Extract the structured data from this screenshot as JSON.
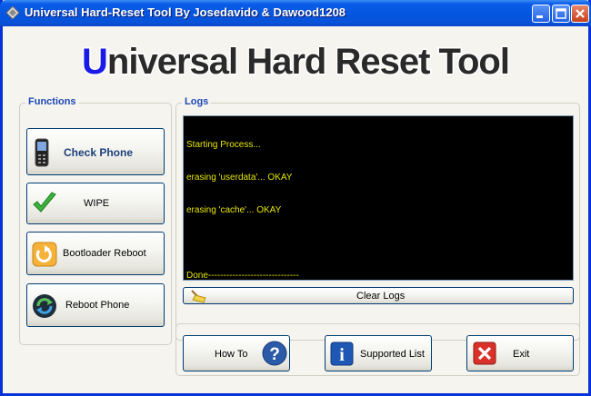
{
  "window": {
    "title": "Universal Hard-Reset Tool By Josedavido & Dawood1208"
  },
  "banner": {
    "text": "Universal Hard Reset Tool",
    "first_letter_color": "#1A1AE6",
    "text_color": "#222222"
  },
  "functions": {
    "label": "Functions",
    "buttons": [
      {
        "label": "Check Phone",
        "icon": "phone-icon"
      },
      {
        "label": "WIPE",
        "icon": "checkmark-icon"
      },
      {
        "label": "Bootloader Reboot",
        "icon": "reboot-arrow-icon"
      },
      {
        "label": "Reboot Phone",
        "icon": "refresh-circle-icon"
      }
    ]
  },
  "logs": {
    "label": "Logs",
    "lines": [
      "Starting Process...",
      "erasing 'userdata'... OKAY",
      "erasing 'cache'... OKAY",
      "",
      "Done------------------------------"
    ],
    "clear_label": "Clear Logs",
    "text_color": "#E6E600"
  },
  "bottom": {
    "howto_label": "How To",
    "supported_label": "Supported List",
    "exit_label": "Exit"
  }
}
